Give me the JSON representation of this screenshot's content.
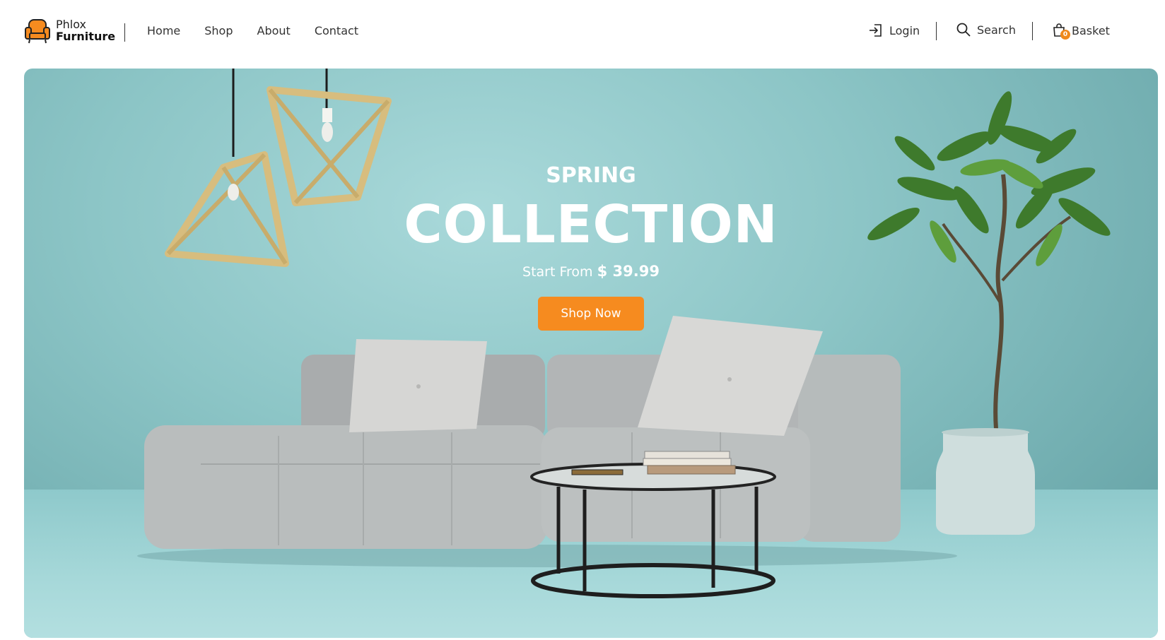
{
  "brand": {
    "line1": "Phlox",
    "line2": "Furniture"
  },
  "nav": {
    "items": [
      {
        "label": "Home"
      },
      {
        "label": "Shop"
      },
      {
        "label": "About"
      },
      {
        "label": "Contact"
      }
    ]
  },
  "utilities": {
    "login_label": "Login",
    "search_label": "Search",
    "basket_label": "Basket",
    "basket_count": "0"
  },
  "hero": {
    "eyebrow": "SPRING",
    "headline": "COLLECTION",
    "price_prefix": "Start From",
    "price": "$ 39.99",
    "cta_label": "Shop Now"
  },
  "colors": {
    "accent": "#f68b1f",
    "hero_bg": "#8cc5c6",
    "text": "#333333"
  },
  "icons": {
    "login": "login-arrow-icon",
    "search": "search-icon",
    "basket": "shopping-bag-icon",
    "logo": "armchair-logo-icon"
  }
}
